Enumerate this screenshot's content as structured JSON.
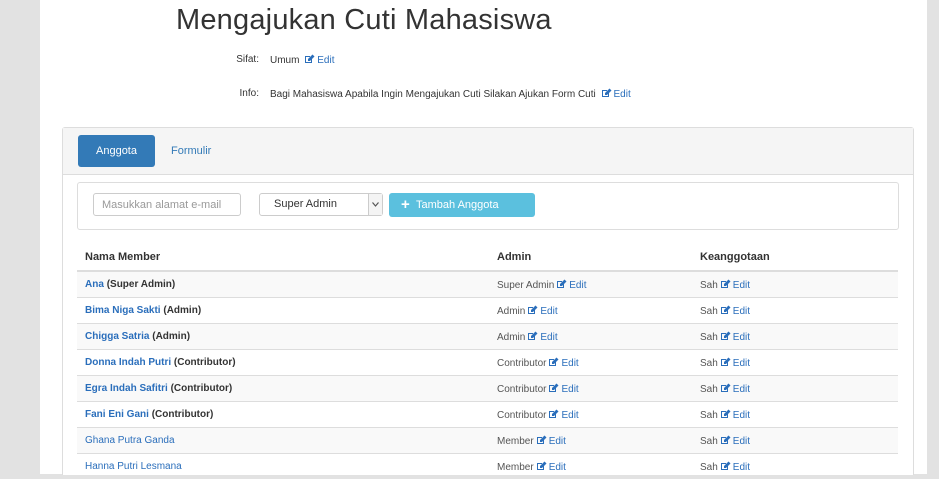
{
  "page": {
    "title": "Mengajukan Cuti Mahasiswa",
    "sifat_label": "Sifat:",
    "sifat_value": "Umum",
    "info_label": "Info:",
    "info_value": "Bagi Mahasiswa Apabila Ingin Mengajukan Cuti Silakan Ajukan Form Cuti",
    "edit_label": "Edit"
  },
  "tabs": [
    {
      "label": "Anggota",
      "active": true
    },
    {
      "label": "Formulir",
      "active": false
    }
  ],
  "add_member": {
    "email_placeholder": "Masukkan alamat e-mail",
    "role_selected": "Super Admin",
    "add_button": "Tambah Anggota"
  },
  "table": {
    "headers": [
      "Nama Member",
      "Admin",
      "Keanggotaan"
    ],
    "rows": [
      {
        "name": "Ana",
        "role": "(Super Admin)",
        "admin": "Super Admin",
        "status": "Sah",
        "bold": true
      },
      {
        "name": "Bima Niga Sakti",
        "role": "(Admin)",
        "admin": "Admin",
        "status": "Sah",
        "bold": true
      },
      {
        "name": "Chigga Satria",
        "role": "(Admin)",
        "admin": "Admin",
        "status": "Sah",
        "bold": true
      },
      {
        "name": "Donna Indah Putri",
        "role": "(Contributor)",
        "admin": "Contributor",
        "status": "Sah",
        "bold": true
      },
      {
        "name": "Egra Indah Safitri",
        "role": "(Contributor)",
        "admin": "Contributor",
        "status": "Sah",
        "bold": true
      },
      {
        "name": "Fani Eni Gani",
        "role": "(Contributor)",
        "admin": "Contributor",
        "status": "Sah",
        "bold": true
      },
      {
        "name": "Ghana Putra Ganda",
        "role": "",
        "admin": "Member",
        "status": "Sah",
        "bold": false
      },
      {
        "name": "Hanna Putri Lesmana",
        "role": "",
        "admin": "Member",
        "status": "Sah",
        "bold": false
      }
    ]
  },
  "colors": {
    "primary": "#337ab7",
    "link": "#2a6ebb",
    "info_button": "#5bc0de"
  }
}
